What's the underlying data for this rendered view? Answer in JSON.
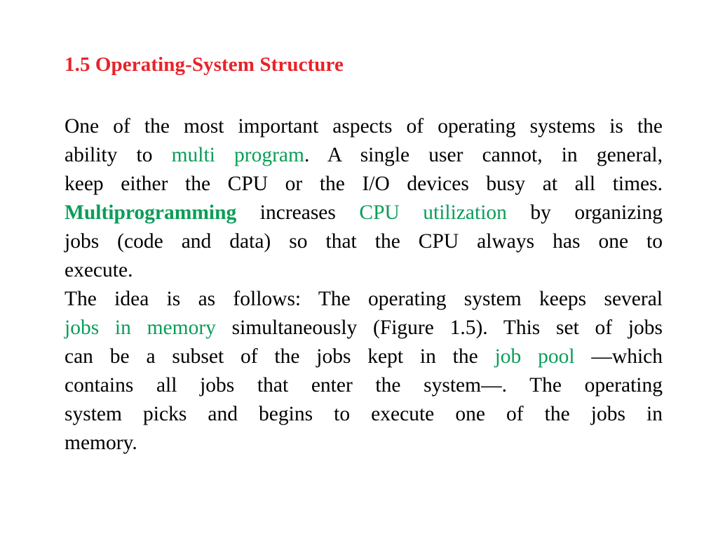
{
  "slide": {
    "title": "1.5 Operating-System Structure",
    "title_color": "#e8232a",
    "background_color": "#ffffff",
    "text_color": "#000000",
    "highlight_color": "#0a9d58"
  },
  "paragraph1": {
    "lines": [
      {
        "id": "p1l1",
        "text": "One of the most important aspects of operating systems is the"
      },
      {
        "id": "p1l2",
        "text": "ability to multi program. A single user cannot, in general,"
      },
      {
        "id": "p1l3",
        "text": "keep either the CPU or the I/O devices busy at all times."
      },
      {
        "id": "p1l4",
        "text": "Multiprogramming increases CPU utilization by organizing"
      },
      {
        "id": "p1l5",
        "text": "jobs (code and data) so that the CPU always has one to"
      },
      {
        "id": "p1l6",
        "text": "execute."
      }
    ],
    "seg_l2_a": "ability  to  ",
    "seg_l2_green": "multi program",
    "seg_l2_b": ".  A  single  user  cannot,  in  general,",
    "seg_l4_green_bold": "Multiprogramming",
    "seg_l4_a": " increases ",
    "seg_l4_green": "CPU utilization",
    "seg_l4_b": " by organizing",
    "full_text": "One of the most important aspects of operating systems is the ability to multi program. A single user cannot, in general, keep either the CPU or the I/O devices busy at all times. Multiprogramming increases CPU utilization by organizing jobs (code and data) so that the CPU always has one to execute."
  },
  "paragraph2": {
    "lines": [
      {
        "id": "p2l1",
        "text": "The idea is as follows: The operating system keeps several"
      },
      {
        "id": "p2l2",
        "text": "jobs in memory simultaneously (Figure 1.5). This set of jobs"
      },
      {
        "id": "p2l3",
        "text": "can be a subset of the jobs kept in the job pool —which"
      },
      {
        "id": "p2l4",
        "text": "contains all jobs that enter the system—. The operating"
      },
      {
        "id": "p2l5",
        "text": "system picks and begins to execute one of the jobs in"
      },
      {
        "id": "p2l6",
        "text": "memory."
      }
    ],
    "seg_l2_green": "jobs in memory",
    "seg_l2_rest": " simultaneously (Figure 1.5). This set of jobs",
    "seg_l3_a": "can  be  a  subset  of  the  jobs  kept  in  the  ",
    "seg_l3_green": "job pool",
    "seg_l3_b": " —which",
    "full_text": "The idea is as follows: The operating system keeps several jobs in memory simultaneously (Figure 1.5). This set of jobs can be a subset of the jobs kept in the job pool —which contains all jobs that enter the system—. The operating system picks and begins to execute one of the jobs in memory."
  },
  "highlighted_terms": [
    "multi program",
    "Multiprogramming",
    "CPU utilization",
    "jobs in memory",
    "job pool"
  ]
}
